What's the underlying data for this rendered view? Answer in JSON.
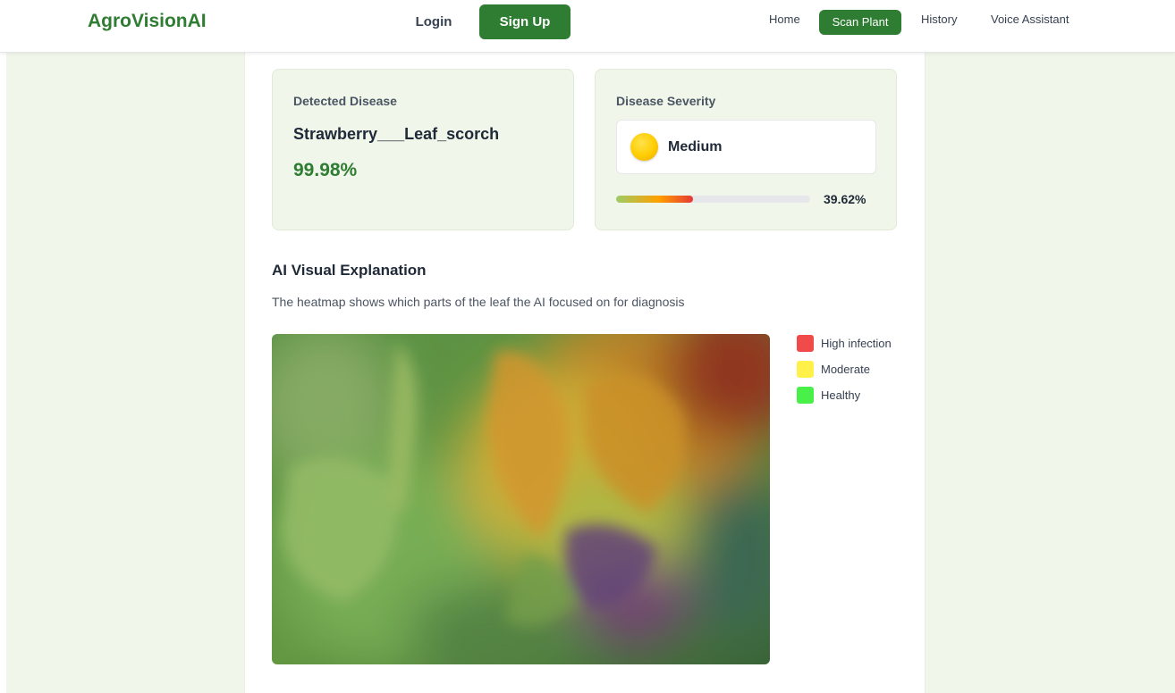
{
  "navbar": {
    "brand": "AgroVisionAI",
    "login_label": "Login",
    "signup_label": "Sign Up",
    "links": [
      {
        "label": "Home"
      },
      {
        "label": "Scan Plant",
        "active": true
      },
      {
        "label": "History"
      },
      {
        "label": "Voice Assistant"
      }
    ]
  },
  "detected": {
    "label": "Detected Disease",
    "disease": "Strawberry___Leaf_scorch",
    "confidence": "99.98%"
  },
  "severity": {
    "label": "Disease Severity",
    "icon": "yellow-circle-icon",
    "level": "Medium",
    "percent_text": "39.62%",
    "fraction": 0.3962
  },
  "explanation": {
    "title": "AI Visual Explanation",
    "description": "The heatmap shows which parts of the leaf the AI focused on for diagnosis"
  },
  "legend": [
    {
      "label": "High infection",
      "color": "#f04a4a"
    },
    {
      "label": "Moderate",
      "color": "#fff04a"
    },
    {
      "label": "Healthy",
      "color": "#4af04a"
    }
  ],
  "colors": {
    "brand_green": "#2e7d32",
    "page_bg": "#f1f6ea",
    "card_bg": "#f0f6e9"
  }
}
